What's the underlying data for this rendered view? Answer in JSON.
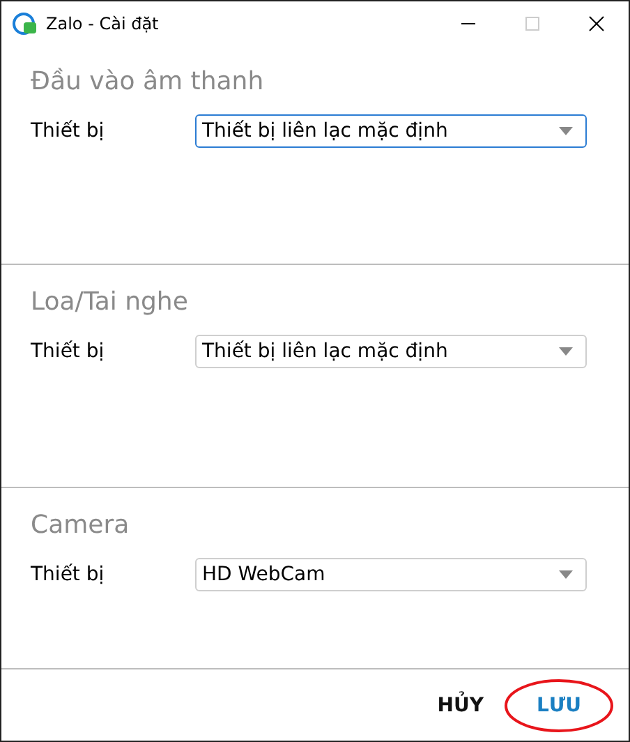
{
  "window": {
    "title": "Zalo - Cài đặt",
    "maximize_disabled": true
  },
  "sections": [
    {
      "title": "Đầu vào âm thanh",
      "label": "Thiết bị",
      "value": "Thiết bị liên lạc mặc định",
      "focused": true
    },
    {
      "title": "Loa/Tai nghe",
      "label": "Thiết bị",
      "value": "Thiết bị liên lạc mặc định",
      "focused": false
    },
    {
      "title": "Camera",
      "label": "Thiết bị",
      "value": "HD WebCam",
      "focused": false
    }
  ],
  "buttons": [
    {
      "label": "HỦY",
      "kind": "cancel"
    },
    {
      "label": "LƯU",
      "kind": "save"
    }
  ]
}
